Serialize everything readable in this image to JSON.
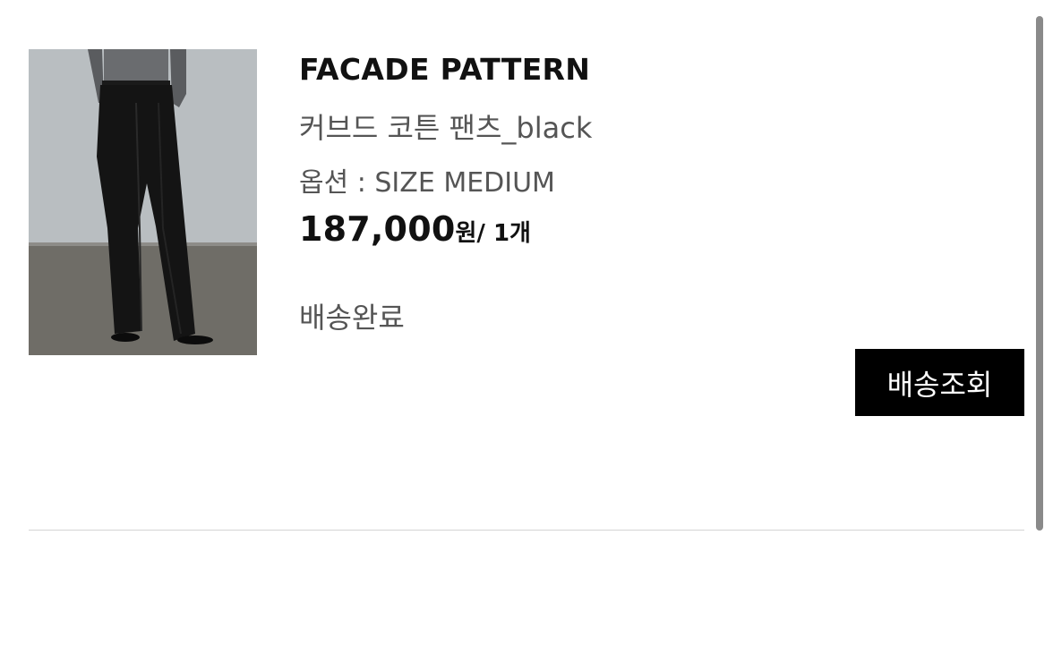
{
  "order_item": {
    "brand": "FACADE PATTERN",
    "product_name": "커브드 코튼 팬츠_black",
    "option": "옵션 : SIZE MEDIUM",
    "price": "187,000",
    "price_unit": "원/ 1개",
    "status": "배송완료",
    "track_button_label": "배송조회",
    "image_icon": "product-photo-black-pants"
  },
  "colors": {
    "button_bg": "#000000",
    "button_text": "#ffffff",
    "secondary_text": "#555555"
  }
}
